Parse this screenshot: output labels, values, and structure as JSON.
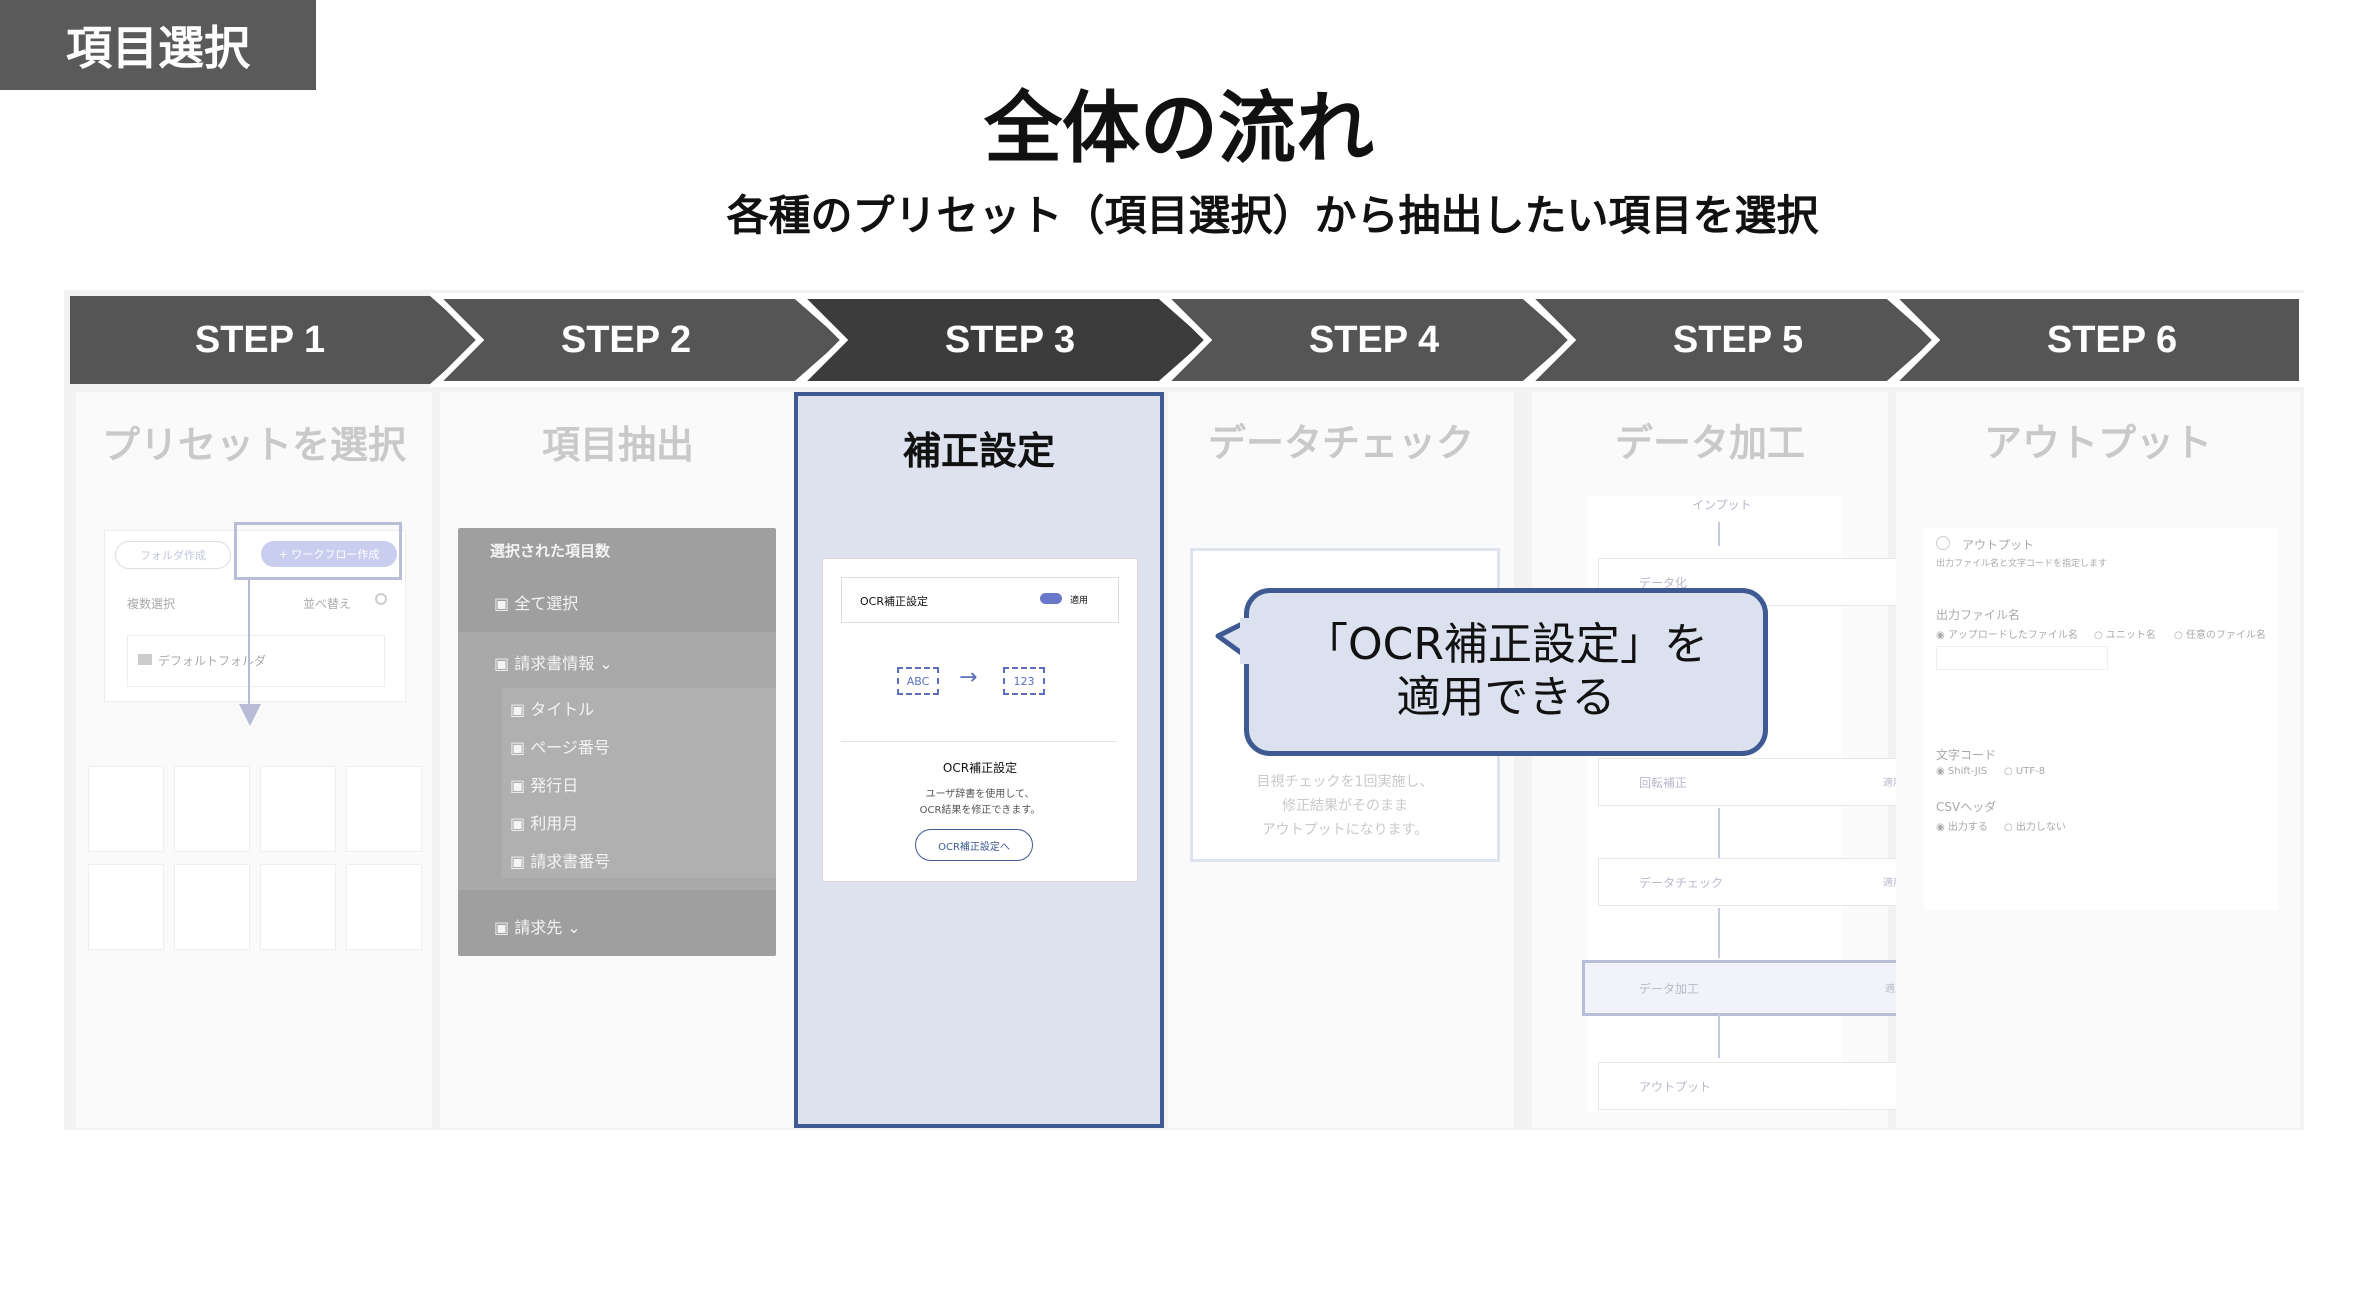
{
  "corner_tag": "項目選択",
  "title": "全体の流れ",
  "subtitle": "各種のプリセット（項目選択）から抽出したい項目を選択",
  "steps": [
    {
      "label": "STEP 1",
      "title": "プリセットを選択"
    },
    {
      "label": "STEP 2",
      "title": "項目抽出"
    },
    {
      "label": "STEP 3",
      "title": "補正設定"
    },
    {
      "label": "STEP 4",
      "title": "データチェック"
    },
    {
      "label": "STEP 5",
      "title": "データ加工"
    },
    {
      "label": "STEP 6",
      "title": "アウトプット"
    }
  ],
  "colors": {
    "step_bar": "#555555",
    "active_step_bar": "#3c3c3c",
    "accent": "#3f5993",
    "active_bg": "#dde2ee"
  },
  "step1": {
    "folder_button": "フォルダ作成",
    "workflow_button": "+ ワークフロー作成",
    "multi_select": "複数選択",
    "sort": "並べ替え",
    "default_folder": "デフォルトフォルダ",
    "icons": [
      "folder-icon",
      "gear-icon",
      "arrow-down-icon"
    ]
  },
  "step2": {
    "header": "選択された項目数",
    "select_all": "全て選択",
    "group_label": "請求書情報",
    "items": [
      "タイトル",
      "ページ番号",
      "発行日",
      "利用月",
      "請求書番号"
    ],
    "bottom": "請求先"
  },
  "step3": {
    "toggle_label": "OCR補正設定",
    "toggle_state": "適用",
    "abc": "ABC",
    "num": "123",
    "card_title": "OCR補正設定",
    "card_desc_1": "ユーザ辞書を使用して、",
    "card_desc_2": "OCR結果を修正できます。",
    "card_button": "OCR補正設定へ"
  },
  "step4": {
    "desc_1": "目視チェックを1回実施し、",
    "desc_2": "修正結果がそのまま",
    "desc_3": "アウトプットになります。"
  },
  "step5": {
    "input": "インプット",
    "nodes": [
      {
        "label": "データ化",
        "state": ""
      },
      {
        "label": "回転補正",
        "state": "適用"
      },
      {
        "label": "データチェック",
        "state": "適用"
      },
      {
        "label": "データ加工",
        "state": "適用"
      },
      {
        "label": "アウトプット",
        "state": ""
      }
    ]
  },
  "step6": {
    "header": "アウトプット",
    "header_sub": "出力ファイル名と文字コードを指定します",
    "filename_label": "出力ファイル名",
    "opt1": "アップロードしたファイル名",
    "opt2": "ユニット名",
    "opt3": "任意のファイル名",
    "encoding_label": "文字コード",
    "enc1": "Shift-JIS",
    "enc2": "UTF-8",
    "csv_label": "CSVヘッダ",
    "csv1": "出力する",
    "csv2": "出力しない"
  },
  "callout": {
    "line1": "「OCR補正設定」を",
    "line2": "適用できる"
  }
}
